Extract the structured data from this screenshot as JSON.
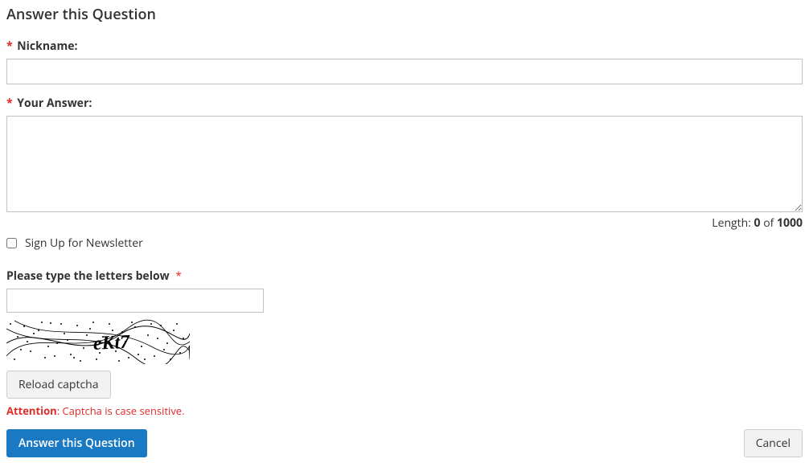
{
  "title": "Answer this Question",
  "required_marker": "*",
  "fields": {
    "nickname": {
      "label": "Nickname:",
      "value": ""
    },
    "answer": {
      "label": "Your Answer:",
      "value": ""
    }
  },
  "length_counter": {
    "prefix": "Length: ",
    "current": "0",
    "separator": " of ",
    "max": "1000"
  },
  "newsletter": {
    "label": "Sign Up for Newsletter",
    "checked": false
  },
  "captcha": {
    "label": "Please type the letters below",
    "value": "",
    "image_text": "eKt7",
    "reload_label": "Reload captcha",
    "attention_label": "Attention",
    "attention_text": ": Captcha is case sensitive."
  },
  "actions": {
    "submit_label": "Answer this Question",
    "cancel_label": "Cancel"
  }
}
